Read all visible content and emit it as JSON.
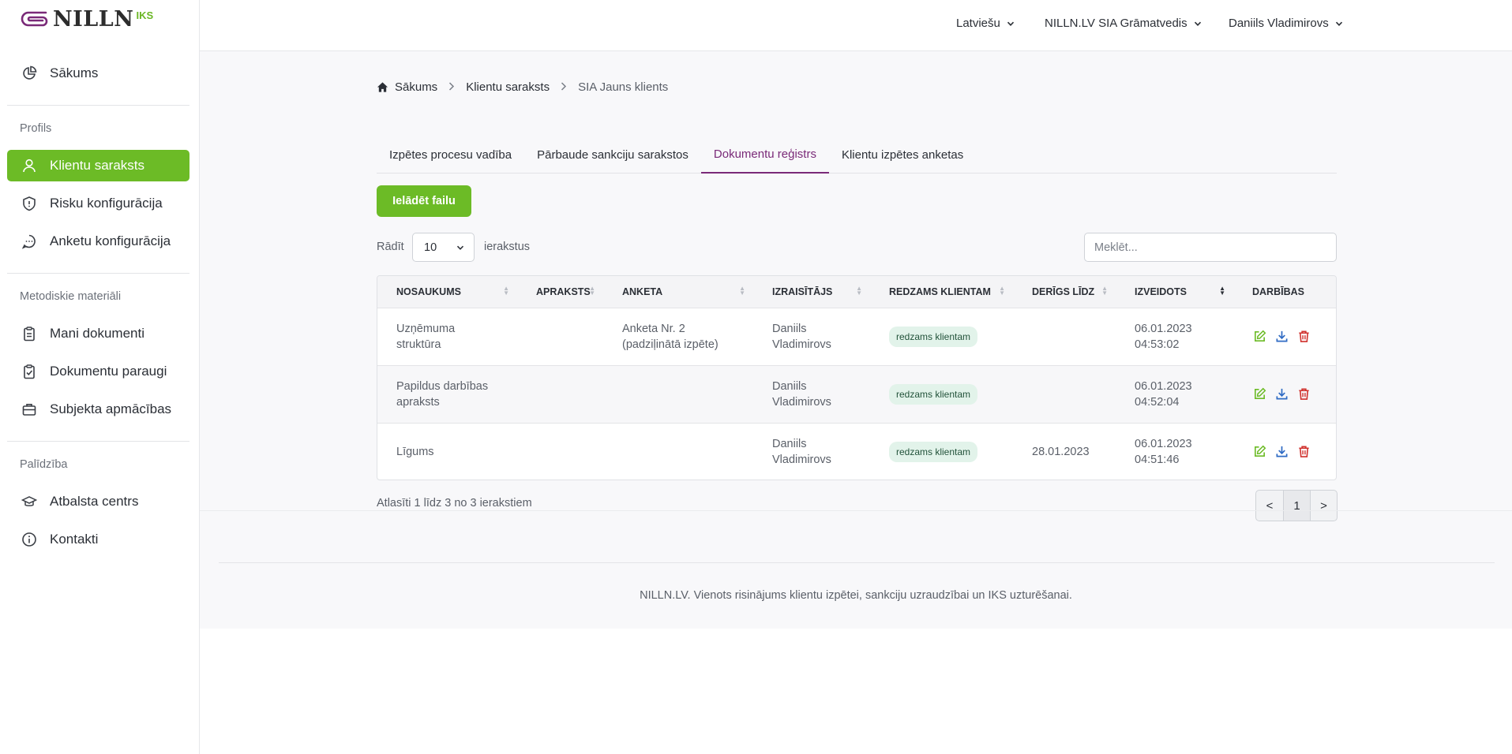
{
  "brand": {
    "name": "NILLN",
    "suffix": "IKS",
    "accent": "#6cbb26",
    "logo_color": "#7a2a78"
  },
  "header": {
    "language": "Latviešu",
    "company": "NILLN.LV SIA Grāmatvedis",
    "user": "Daniils Vladimirovs"
  },
  "sidebar": {
    "home": {
      "label": "Sākums",
      "icon": "pie-chart-icon"
    },
    "section_profile": "Profils",
    "profile_items": [
      {
        "label": "Klientu saraksts",
        "icon": "user-icon"
      },
      {
        "label": "Risku konfigurācija",
        "icon": "shield-icon"
      },
      {
        "label": "Anketu konfigurācija",
        "icon": "chat-bubble-icon"
      }
    ],
    "section_methods": "Metodiskie materiāli",
    "method_items": [
      {
        "label": "Mani dokumenti",
        "icon": "clipboard-icon"
      },
      {
        "label": "Dokumentu paraugi",
        "icon": "clipboard-check-icon"
      },
      {
        "label": "Subjekta apmācības",
        "icon": "briefcase-icon"
      }
    ],
    "section_help": "Palīdzība",
    "help_items": [
      {
        "label": "Atbalsta centrs",
        "icon": "graduation-cap-icon"
      },
      {
        "label": "Kontakti",
        "icon": "info-icon"
      }
    ]
  },
  "breadcrumb": {
    "home": "Sākums",
    "list": "Klientu saraksts",
    "current": "SIA Jauns klients"
  },
  "tabs": [
    "Izpētes procesu vadība",
    "Pārbaude sankciju sarakstos",
    "Dokumentu reģistrs",
    "Klientu izpētes anketas"
  ],
  "upload_label": "Ielādēt failu",
  "table_controls": {
    "show_label": "Rādīt",
    "show_value": "10",
    "entries_label": "ierakstus",
    "search_placeholder": "Meklēt..."
  },
  "table": {
    "columns": [
      "Nosaukums",
      "Apraksts",
      "Anketa",
      "Izraisītājs",
      "Redzams klientam",
      "Derīgs līdz",
      "Izveidots",
      "Darbības"
    ],
    "rows": [
      {
        "name": [
          "Uzņēmuma",
          "struktūra"
        ],
        "description": "",
        "form": [
          "Anketa Nr. 2",
          "(padziļinātā izpēte)"
        ],
        "author": [
          "Daniils",
          "Vladimirovs"
        ],
        "visible": "redzams klientam",
        "valid_until": "",
        "created": [
          "06.01.2023",
          "04:53:02"
        ]
      },
      {
        "name": [
          "Papildus darbības",
          "apraksts"
        ],
        "description": "",
        "form": [
          "",
          ""
        ],
        "author": [
          "Daniils",
          "Vladimirovs"
        ],
        "visible": "redzams klientam",
        "valid_until": "",
        "created": [
          "06.01.2023",
          "04:52:04"
        ]
      },
      {
        "name": [
          "Līgums",
          ""
        ],
        "description": "",
        "form": [
          "",
          ""
        ],
        "author": [
          "Daniils",
          "Vladimirovs"
        ],
        "visible": "redzams klientam",
        "valid_until": "28.01.2023",
        "created": [
          "06.01.2023",
          "04:51:46"
        ]
      }
    ]
  },
  "table_info": "Atlasīti 1 līdz 3 no 3 ierakstiem",
  "pagination": {
    "prev": "<",
    "page": "1",
    "next": ">"
  },
  "footer": "NILLN.LV. Vienots risinājums klientu izpētei, sankciju uzraudzībai un IKS uzturēšanai."
}
